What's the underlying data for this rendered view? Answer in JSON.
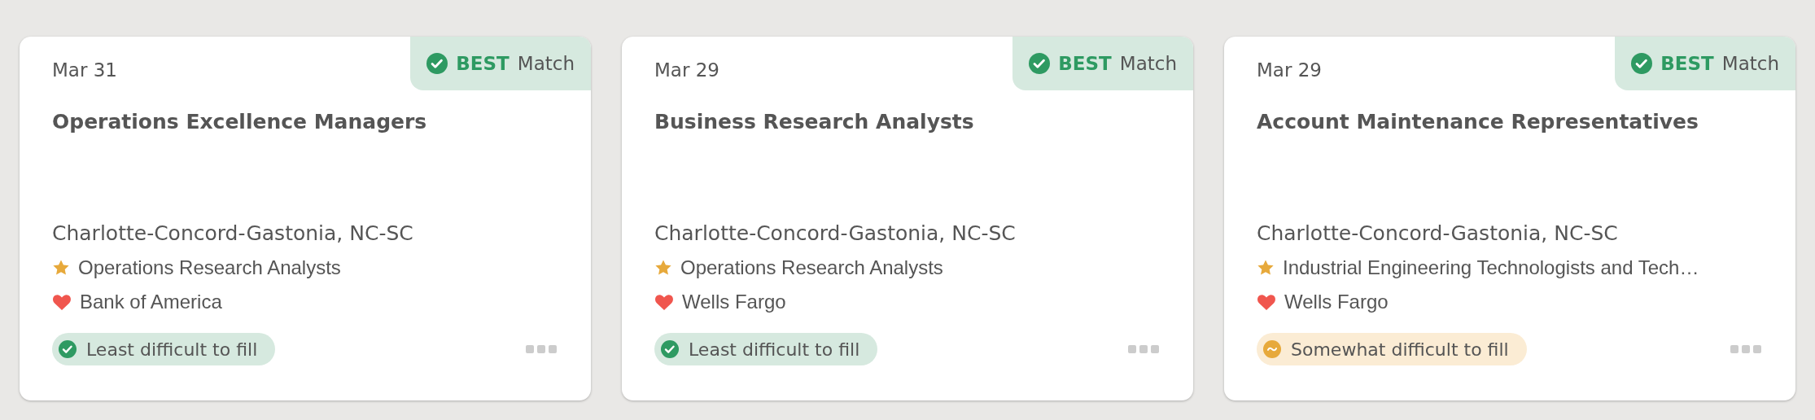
{
  "cards": [
    {
      "date": "Mar 31",
      "match": {
        "level": "BEST",
        "label": "Match"
      },
      "title": "Operations Excellence Managers",
      "location": "Charlotte-Concord-Gastonia, NC-SC",
      "occupation": "Operations Research Analysts",
      "employer": "Bank of America",
      "difficulty": {
        "kind": "least",
        "label": "Least difficult to fill"
      }
    },
    {
      "date": "Mar 29",
      "match": {
        "level": "BEST",
        "label": "Match"
      },
      "title": "Business Research Analysts",
      "location": "Charlotte-Concord-Gastonia, NC-SC",
      "occupation": "Operations Research Analysts",
      "employer": "Wells Fargo",
      "difficulty": {
        "kind": "least",
        "label": "Least difficult to fill"
      }
    },
    {
      "date": "Mar 29",
      "match": {
        "level": "BEST",
        "label": "Match"
      },
      "title": "Account Maintenance Representatives",
      "location": "Charlotte-Concord-Gastonia, NC-SC",
      "occupation": "Industrial Engineering Technologists and Tech…",
      "employer": "Wells Fargo",
      "difficulty": {
        "kind": "somewhat",
        "label": "Somewhat difficult to fill"
      }
    }
  ]
}
